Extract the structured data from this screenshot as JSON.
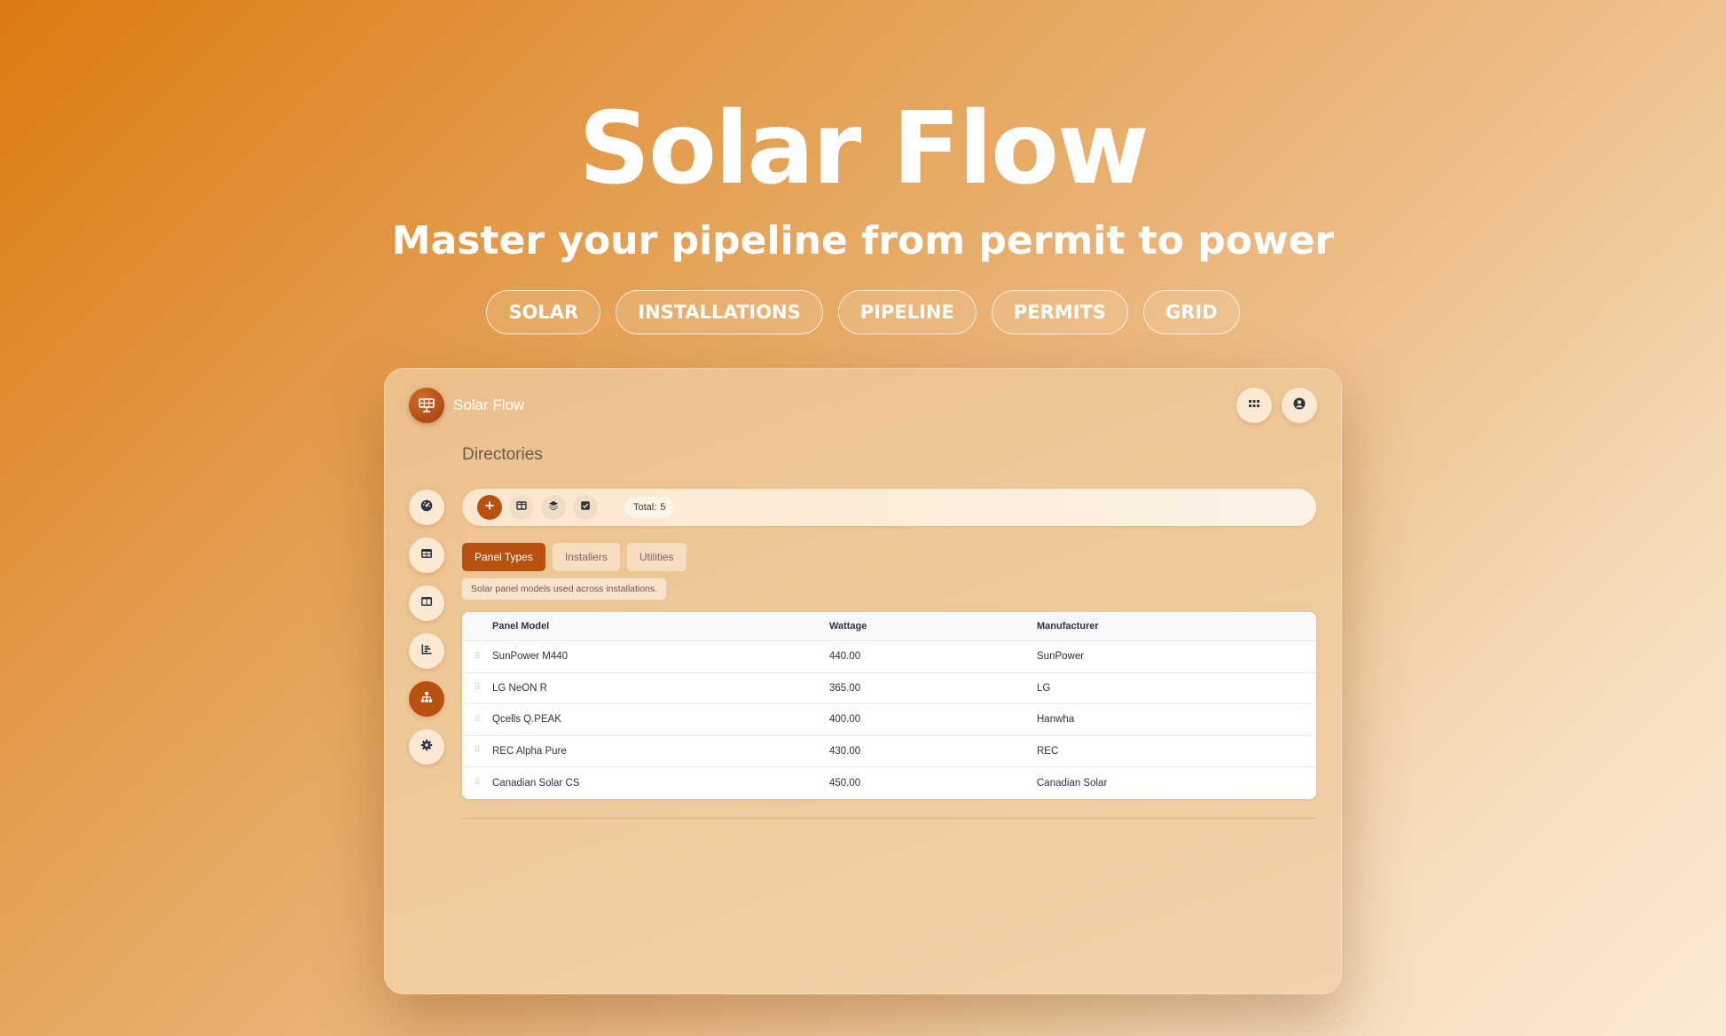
{
  "hero": {
    "title": "Solar Flow",
    "subtitle": "Master your pipeline from permit to power",
    "tags": [
      "SOLAR",
      "INSTALLATIONS",
      "PIPELINE",
      "PERMITS",
      "GRID"
    ]
  },
  "app": {
    "brand_name": "Solar Flow",
    "page_title": "Directories",
    "top_actions": [
      {
        "icon": "apps-grid-icon"
      },
      {
        "icon": "user-account-icon"
      }
    ],
    "sidebar": {
      "items": [
        {
          "icon": "dashboard-gauge-icon",
          "active": false
        },
        {
          "icon": "table-icon",
          "active": false
        },
        {
          "icon": "columns-icon",
          "active": false
        },
        {
          "icon": "chart-icon",
          "active": false
        },
        {
          "icon": "hierarchy-icon",
          "active": true
        },
        {
          "icon": "settings-gear-icon",
          "active": false
        }
      ]
    },
    "toolbar": {
      "buttons": [
        "add-icon",
        "columns-icon",
        "layers-icon",
        "checkbox-icon"
      ],
      "total_label": "Total:",
      "total_value": "5"
    },
    "tabs": [
      {
        "label": "Panel Types",
        "active": true
      },
      {
        "label": "Installers",
        "active": false
      },
      {
        "label": "Utilities",
        "active": false
      }
    ],
    "description": "Solar panel models used across installations.",
    "table": {
      "columns": [
        "Panel Model",
        "Wattage",
        "Manufacturer"
      ],
      "rows": [
        [
          "SunPower M440",
          "440.00",
          "SunPower"
        ],
        [
          "LG NeON R",
          "365.00",
          "LG"
        ],
        [
          "Qcells Q.PEAK",
          "400.00",
          "Hanwha"
        ],
        [
          "REC Alpha Pure",
          "430.00",
          "REC"
        ],
        [
          "Canadian Solar CS",
          "450.00",
          "Canadian Solar"
        ]
      ]
    }
  },
  "colors": {
    "accent": "#b8500f",
    "background_start": "#dc7a10",
    "background_end": "#fae9d3"
  }
}
